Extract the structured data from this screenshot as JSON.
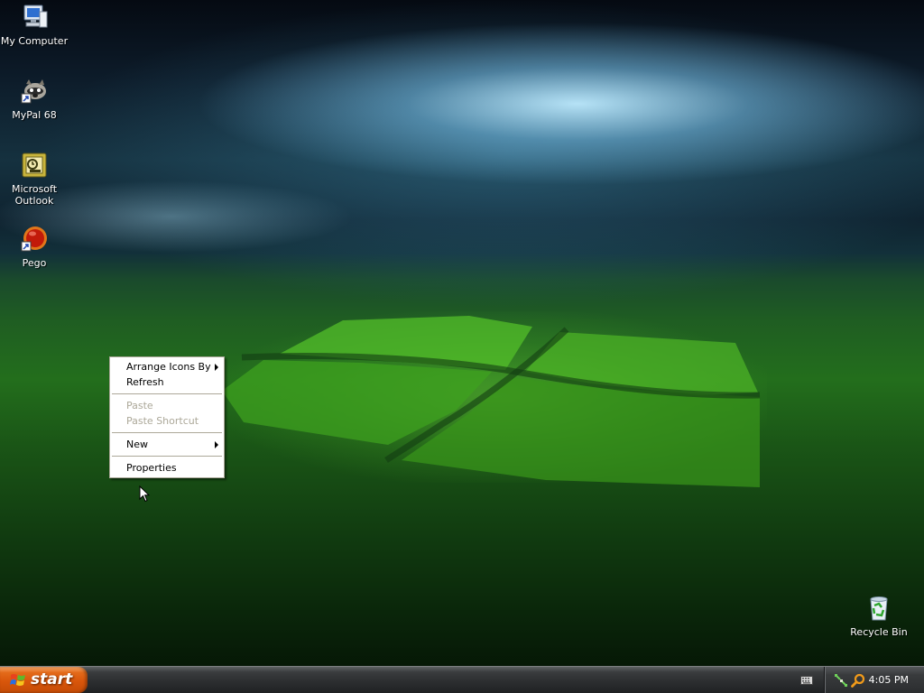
{
  "desktop": {
    "icons": [
      {
        "label": "My Computer",
        "icon": "my-computer-icon"
      },
      {
        "label": "MyPal 68",
        "icon": "mypal-raccoon-icon"
      },
      {
        "label": "Microsoft Outlook",
        "icon": "outlook-icon"
      },
      {
        "label": "Pego",
        "icon": "pego-icon"
      },
      {
        "label": "Recycle Bin",
        "icon": "recycle-bin-icon"
      }
    ]
  },
  "context_menu": {
    "items": [
      {
        "label": "Arrange Icons By",
        "enabled": true,
        "submenu": true
      },
      {
        "label": "Refresh",
        "enabled": true,
        "submenu": false
      },
      {
        "label": "Paste",
        "enabled": false,
        "submenu": false
      },
      {
        "label": "Paste Shortcut",
        "enabled": false,
        "submenu": false
      },
      {
        "label": "New",
        "enabled": true,
        "submenu": true
      },
      {
        "label": "Properties",
        "enabled": true,
        "submenu": false
      }
    ]
  },
  "taskbar": {
    "start_label": "start",
    "clock": "4:05 PM"
  },
  "colors": {
    "start_button": "#d9560b",
    "taskbar": "#2b2d2f",
    "menu_border": "#aca899",
    "disabled_text": "#aca899"
  }
}
